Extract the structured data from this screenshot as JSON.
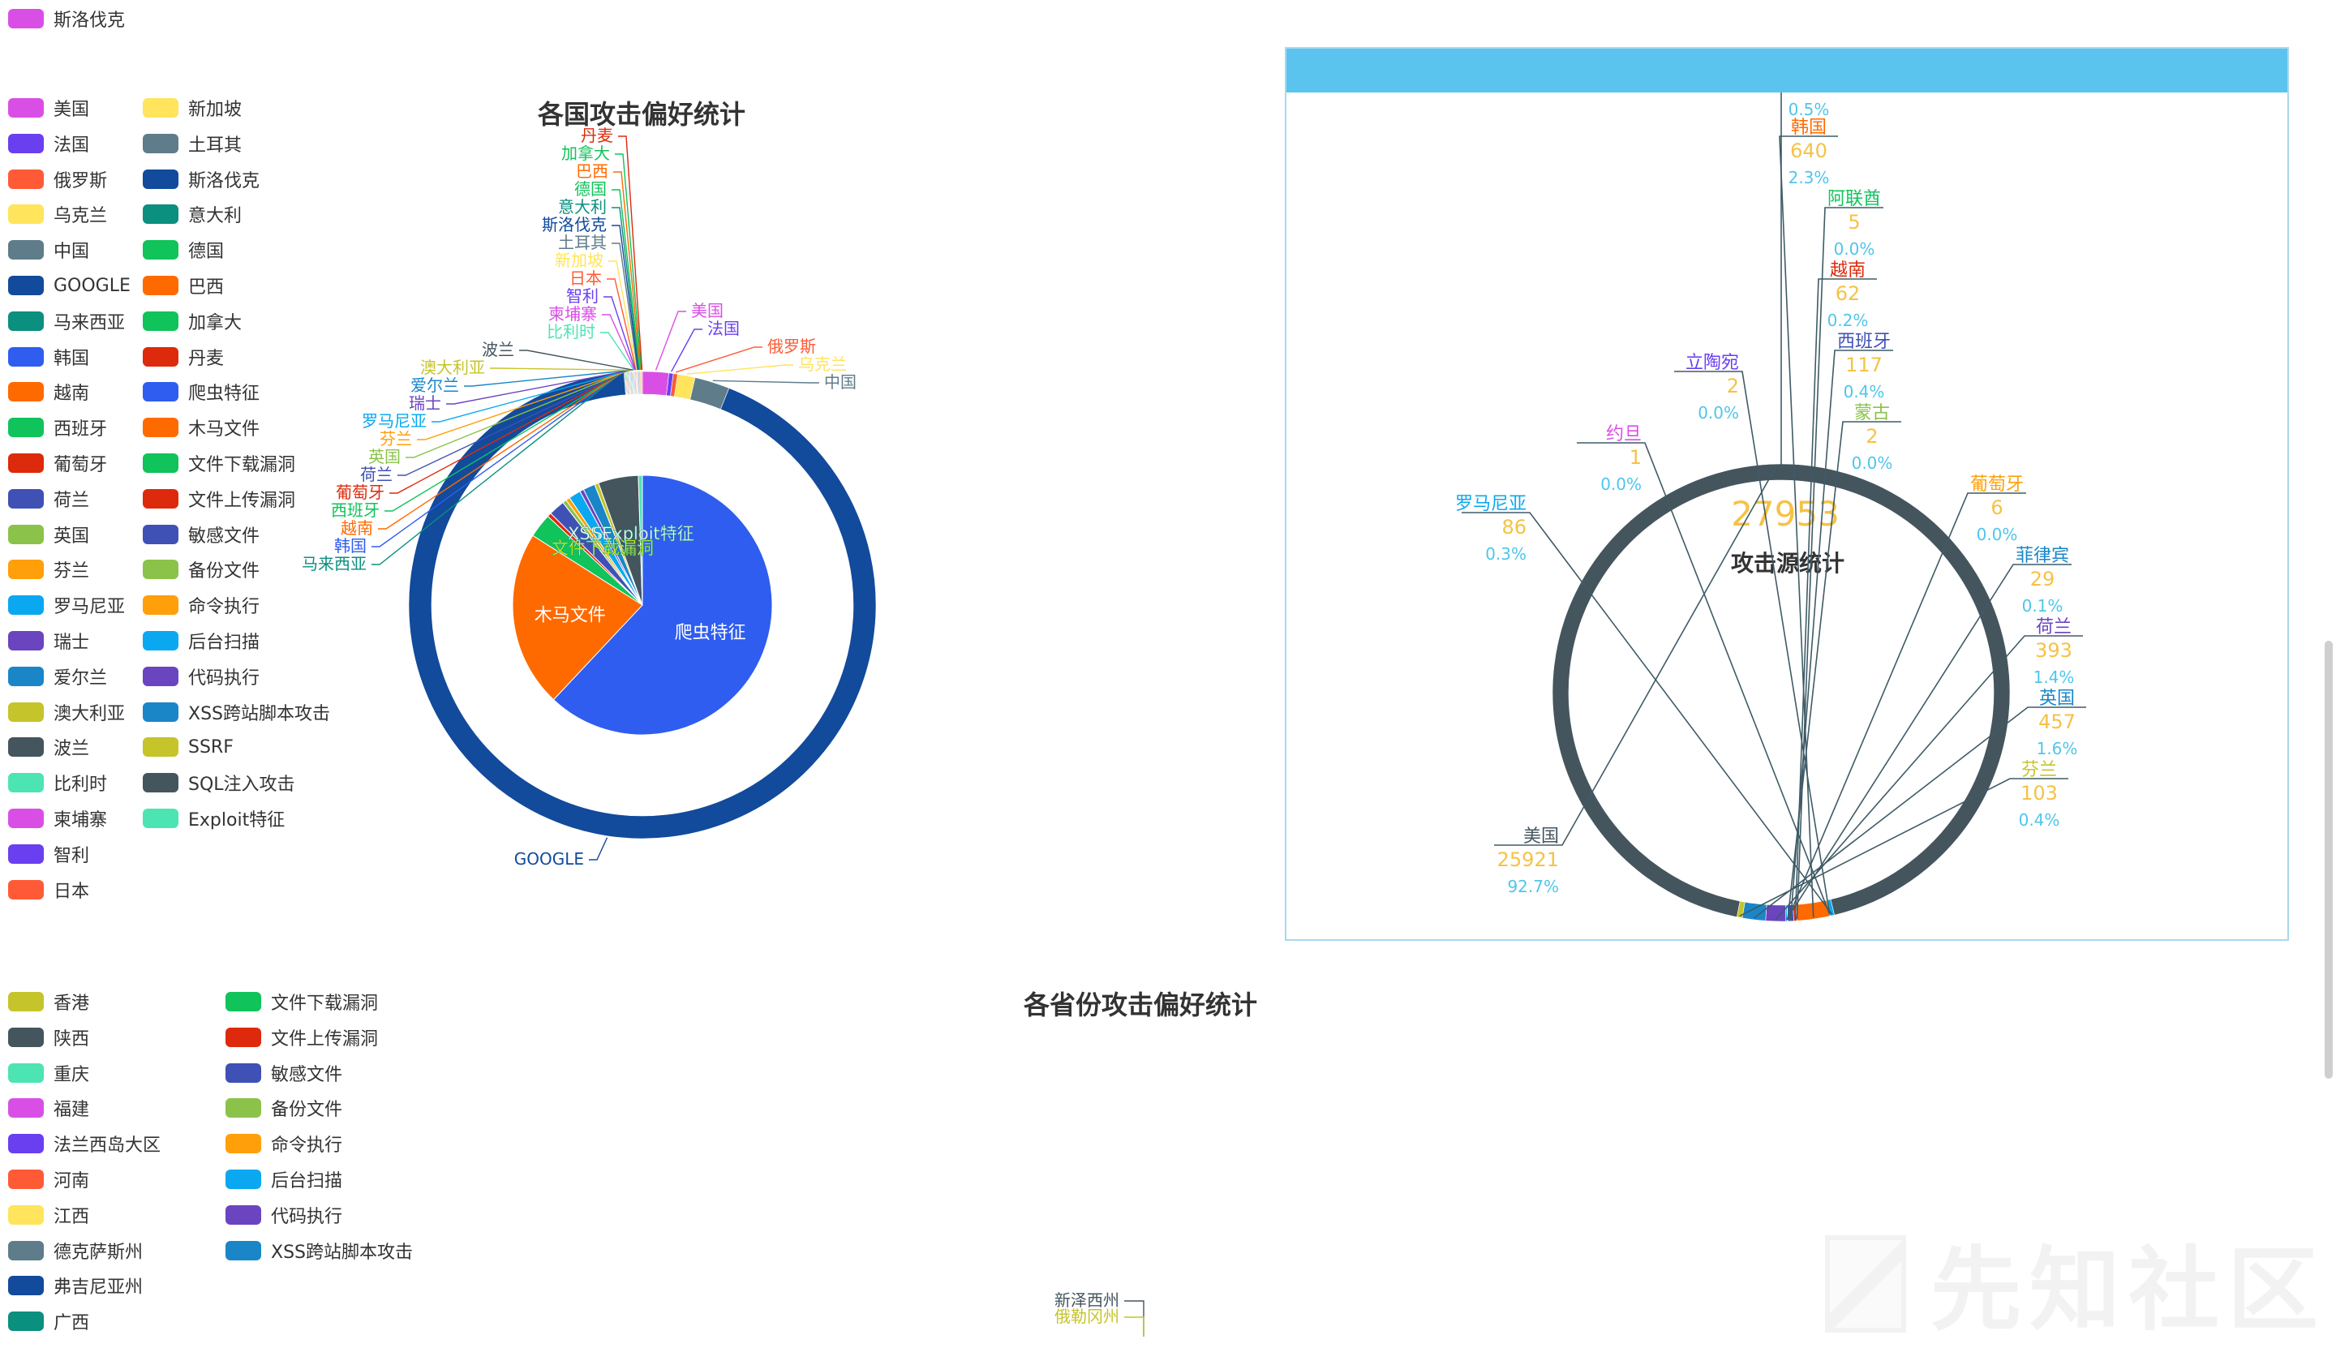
{
  "top_legend": {
    "item": {
      "label": "斯洛伐克",
      "color": "#d94fe6"
    }
  },
  "country_legend": {
    "col1": [
      {
        "label": "美国",
        "color": "#d94fe6"
      },
      {
        "label": "法国",
        "color": "#6a3ff0"
      },
      {
        "label": "俄罗斯",
        "color": "#ff5a36"
      },
      {
        "label": "乌克兰",
        "color": "#ffe45c"
      },
      {
        "label": "中国",
        "color": "#5f7c8a"
      },
      {
        "label": "GOOGLE",
        "color": "#124a9c"
      },
      {
        "label": "马来西亚",
        "color": "#0b8f7f"
      },
      {
        "label": "韩国",
        "color": "#2f5df0"
      },
      {
        "label": "越南",
        "color": "#ff6a00"
      },
      {
        "label": "西班牙",
        "color": "#10c35a"
      },
      {
        "label": "葡萄牙",
        "color": "#dd2a0c"
      },
      {
        "label": "荷兰",
        "color": "#3f51b5"
      },
      {
        "label": "英国",
        "color": "#8bc34a"
      },
      {
        "label": "芬兰",
        "color": "#ff9f0a"
      },
      {
        "label": "罗马尼亚",
        "color": "#0aa8f0"
      },
      {
        "label": "瑞士",
        "color": "#6b44c0"
      },
      {
        "label": "爱尔兰",
        "color": "#1a86c8"
      },
      {
        "label": "澳大利亚",
        "color": "#c5c42a"
      },
      {
        "label": "波兰",
        "color": "#44555e"
      },
      {
        "label": "比利时",
        "color": "#4de4b4"
      },
      {
        "label": "柬埔寨",
        "color": "#d94fe6"
      },
      {
        "label": "智利",
        "color": "#6a3ff0"
      },
      {
        "label": "日本",
        "color": "#ff5a36"
      }
    ],
    "col2": [
      {
        "label": "新加坡",
        "color": "#ffe45c"
      },
      {
        "label": "土耳其",
        "color": "#5f7c8a"
      },
      {
        "label": "斯洛伐克",
        "color": "#124a9c"
      },
      {
        "label": "意大利",
        "color": "#0b8f7f"
      },
      {
        "label": "德国",
        "color": "#10c35a"
      },
      {
        "label": "巴西",
        "color": "#ff6a00"
      },
      {
        "label": "加拿大",
        "color": "#10c35a"
      },
      {
        "label": "丹麦",
        "color": "#dd2a0c"
      },
      {
        "label": "爬虫特征",
        "color": "#2f5df0"
      },
      {
        "label": "木马文件",
        "color": "#ff6a00"
      },
      {
        "label": "文件下载漏洞",
        "color": "#10c35a"
      },
      {
        "label": "文件上传漏洞",
        "color": "#dd2a0c"
      },
      {
        "label": "敏感文件",
        "color": "#3f51b5"
      },
      {
        "label": "备份文件",
        "color": "#8bc34a"
      },
      {
        "label": "命令执行",
        "color": "#ff9f0a"
      },
      {
        "label": "后台扫描",
        "color": "#0aa8f0"
      },
      {
        "label": "代码执行",
        "color": "#6b44c0"
      },
      {
        "label": "XSS跨站脚本攻击",
        "color": "#1a86c8"
      },
      {
        "label": "SSRF",
        "color": "#c5c42a"
      },
      {
        "label": "SQL注入攻击",
        "color": "#44555e"
      },
      {
        "label": "Exploit特征",
        "color": "#4de4b4"
      }
    ]
  },
  "province_legend": {
    "col1": [
      {
        "label": "香港",
        "color": "#c5c42a"
      },
      {
        "label": "陕西",
        "color": "#44555e"
      },
      {
        "label": "重庆",
        "color": "#4de4b4"
      },
      {
        "label": "福建",
        "color": "#d94fe6"
      },
      {
        "label": "法兰西岛大区",
        "color": "#6a3ff0"
      },
      {
        "label": "河南",
        "color": "#ff5a36"
      },
      {
        "label": "江西",
        "color": "#ffe45c"
      },
      {
        "label": "德克萨斯州",
        "color": "#5f7c8a"
      },
      {
        "label": "弗吉尼亚州",
        "color": "#124a9c"
      },
      {
        "label": "广西",
        "color": "#0b8f7f"
      }
    ],
    "col2": [
      {
        "label": "文件下载漏洞",
        "color": "#10c35a"
      },
      {
        "label": "文件上传漏洞",
        "color": "#dd2a0c"
      },
      {
        "label": "敏感文件",
        "color": "#3f51b5"
      },
      {
        "label": "备份文件",
        "color": "#8bc34a"
      },
      {
        "label": "命令执行",
        "color": "#ff9f0a"
      },
      {
        "label": "后台扫描",
        "color": "#0aa8f0"
      },
      {
        "label": "代码执行",
        "color": "#6b44c0"
      },
      {
        "label": "XSS跨站脚本攻击",
        "color": "#1a86c8"
      }
    ]
  },
  "watermark": "先知社区",
  "chart_data": [
    {
      "type": "pie",
      "title": "各国攻击偏好统计",
      "outer_ring": [
        {
          "name": "美国",
          "value": 1.8,
          "color": "#d94fe6"
        },
        {
          "name": "法国",
          "value": 0.3,
          "color": "#6a3ff0"
        },
        {
          "name": "俄罗斯",
          "value": 0.3,
          "color": "#ff5a36"
        },
        {
          "name": "乌克兰",
          "value": 1.2,
          "color": "#ffe45c"
        },
        {
          "name": "中国",
          "value": 2.4,
          "color": "#5f7c8a"
        },
        {
          "name": "GOOGLE",
          "value": 92.0,
          "color": "#124a9c"
        },
        {
          "name": "马来西亚",
          "value": 0.05,
          "color": "#0b8f7f"
        },
        {
          "name": "韩国",
          "value": 0.05,
          "color": "#2f5df0"
        },
        {
          "name": "越南",
          "value": 0.05,
          "color": "#ff6a00"
        },
        {
          "name": "西班牙",
          "value": 0.05,
          "color": "#10c35a"
        },
        {
          "name": "葡萄牙",
          "value": 0.05,
          "color": "#dd2a0c"
        },
        {
          "name": "荷兰",
          "value": 0.05,
          "color": "#3f51b5"
        },
        {
          "name": "英国",
          "value": 0.05,
          "color": "#8bc34a"
        },
        {
          "name": "芬兰",
          "value": 0.05,
          "color": "#ff9f0a"
        },
        {
          "name": "罗马尼亚",
          "value": 0.05,
          "color": "#0aa8f0"
        },
        {
          "name": "瑞士",
          "value": 0.05,
          "color": "#6b44c0"
        },
        {
          "name": "爱尔兰",
          "value": 0.05,
          "color": "#1a86c8"
        },
        {
          "name": "澳大利亚",
          "value": 0.05,
          "color": "#c5c42a"
        },
        {
          "name": "波兰",
          "value": 0.05,
          "color": "#44555e"
        },
        {
          "name": "比利时",
          "value": 0.05,
          "color": "#4de4b4"
        },
        {
          "name": "柬埔寨",
          "value": 0.05,
          "color": "#d94fe6"
        },
        {
          "name": "智利",
          "value": 0.05,
          "color": "#6a3ff0"
        },
        {
          "name": "日本",
          "value": 0.05,
          "color": "#ff5a36"
        },
        {
          "name": "新加坡",
          "value": 0.05,
          "color": "#ffe45c"
        },
        {
          "name": "土耳其",
          "value": 0.05,
          "color": "#5f7c8a"
        },
        {
          "name": "斯洛伐克",
          "value": 0.05,
          "color": "#124a9c"
        },
        {
          "name": "意大利",
          "value": 0.05,
          "color": "#0b8f7f"
        },
        {
          "name": "德国",
          "value": 0.05,
          "color": "#10c35a"
        },
        {
          "name": "巴西",
          "value": 0.05,
          "color": "#ff6a00"
        },
        {
          "name": "加拿大",
          "value": 0.05,
          "color": "#10c35a"
        },
        {
          "name": "丹麦",
          "value": 0.05,
          "color": "#dd2a0c"
        }
      ],
      "inner_pie": [
        {
          "name": "爬虫特征",
          "value": 62,
          "color": "#2f5df0"
        },
        {
          "name": "木马文件",
          "value": 22,
          "color": "#ff6a00"
        },
        {
          "name": "文件下载漏洞",
          "value": 3,
          "color": "#10c35a"
        },
        {
          "name": "文件上传漏洞",
          "value": 0.5,
          "color": "#dd2a0c"
        },
        {
          "name": "敏感文件",
          "value": 2,
          "color": "#3f51b5"
        },
        {
          "name": "备份文件",
          "value": 0.5,
          "color": "#8bc34a"
        },
        {
          "name": "命令执行",
          "value": 0.5,
          "color": "#ff9f0a"
        },
        {
          "name": "后台扫描",
          "value": 1.5,
          "color": "#0aa8f0"
        },
        {
          "name": "代码执行",
          "value": 0.5,
          "color": "#6b44c0"
        },
        {
          "name": "XSS跨站脚本攻击",
          "value": 1.5,
          "color": "#1a86c8"
        },
        {
          "name": "SSRF",
          "value": 0.5,
          "color": "#c5c42a"
        },
        {
          "name": "SQL注入攻击",
          "value": 5,
          "color": "#44555e"
        },
        {
          "name": "Exploit特征",
          "value": 0.5,
          "color": "#4de4b4"
        }
      ],
      "inner_overlay_labels": [
        "XSS",
        "S",
        "Exploit特征",
        "文件下载漏洞"
      ]
    },
    {
      "type": "pie",
      "title": "攻击源统计",
      "total": "27953",
      "slices": [
        {
          "name": "美国",
          "value": 25921,
          "percent": "92.7%",
          "color": "#44555e"
        },
        {
          "name": "罗马尼亚",
          "value": 86,
          "percent": "0.3%",
          "color": "#0aa8f0"
        },
        {
          "name": "约旦",
          "value": 1,
          "percent": "0.0%",
          "color": "#d94fe6"
        },
        {
          "name": "立陶宛",
          "value": 2,
          "percent": "0.0%",
          "color": "#6a3ff0"
        },
        {
          "name": "韩国",
          "value": 640,
          "percent": "2.3%",
          "color": "#ff6a00"
        },
        {
          "name": "阿联酋",
          "value": 5,
          "percent": "0.0%",
          "color": "#10c35a"
        },
        {
          "name": "越南",
          "value": 62,
          "percent": "0.2%",
          "color": "#dd2a0c"
        },
        {
          "name": "西班牙",
          "value": 117,
          "percent": "0.4%",
          "color": "#3f51b5"
        },
        {
          "name": "蒙古",
          "value": 2,
          "percent": "0.0%",
          "color": "#8bc34a"
        },
        {
          "name": "葡萄牙",
          "value": 6,
          "percent": "0.0%",
          "color": "#ff9f0a"
        },
        {
          "name": "菲律宾",
          "value": 29,
          "percent": "0.1%",
          "color": "#0aa8f0"
        },
        {
          "name": "荷兰",
          "value": 393,
          "percent": "1.4%",
          "color": "#6b44c0"
        },
        {
          "name": "英国",
          "value": 457,
          "percent": "1.6%",
          "color": "#1a86c8"
        },
        {
          "name": "芬兰",
          "value": 103,
          "percent": "0.4%",
          "color": "#c5c42a"
        }
      ],
      "top_stray_label": "0.5%"
    },
    {
      "type": "pie",
      "title": "各省份攻击偏好统计",
      "visible_labels": [
        {
          "name": "新泽西州",
          "color": "#44555e"
        },
        {
          "name": "俄勒冈州",
          "color": "#c5c42a"
        }
      ]
    }
  ]
}
